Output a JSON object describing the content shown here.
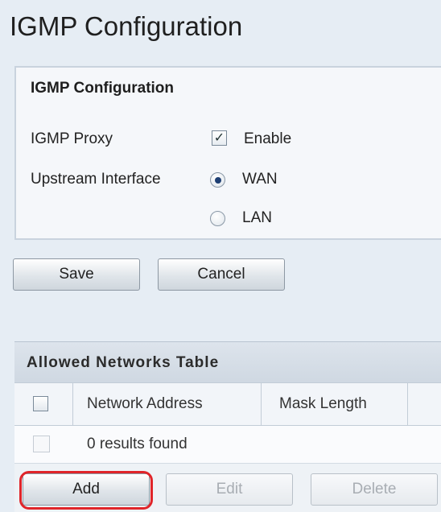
{
  "page": {
    "title": "IGMP Configuration"
  },
  "config": {
    "panel_title": "IGMP Configuration",
    "proxy_label": "IGMP Proxy",
    "proxy_checkbox_mark": "✓",
    "enable_label": "Enable",
    "proxy_enabled": true,
    "upstream_label": "Upstream Interface",
    "options": [
      {
        "label": "WAN",
        "selected": true
      },
      {
        "label": "LAN",
        "selected": false
      }
    ]
  },
  "actions": {
    "save": "Save",
    "cancel": "Cancel"
  },
  "table": {
    "title": "Allowed Networks Table",
    "columns": [
      "Network Address",
      "Mask Length"
    ],
    "results_text": "0 results found"
  },
  "footer": {
    "add": "Add",
    "edit": "Edit",
    "delete": "Delete"
  },
  "colors": {
    "accent": "#1e3f73",
    "highlight": "#e0252a",
    "background": "#e6edf4"
  }
}
